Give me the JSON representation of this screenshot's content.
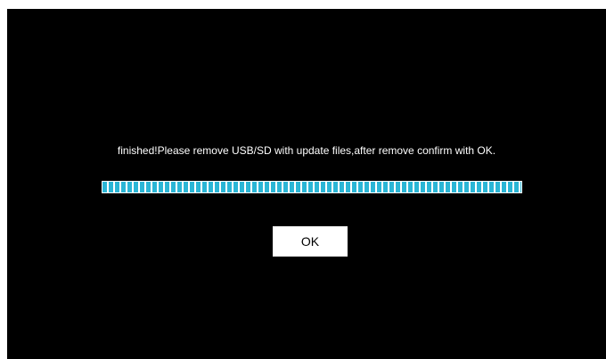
{
  "dialog": {
    "message": "finished!Please remove USB/SD with update files,after remove confirm with OK.",
    "progress": 1.0,
    "ok_label": "OK"
  },
  "colors": {
    "background": "#000000",
    "text": "#ffffff",
    "progress_segment": "#2bb6d6",
    "progress_gap": "#ffffff",
    "button_background": "#ffffff",
    "button_text": "#000000"
  }
}
